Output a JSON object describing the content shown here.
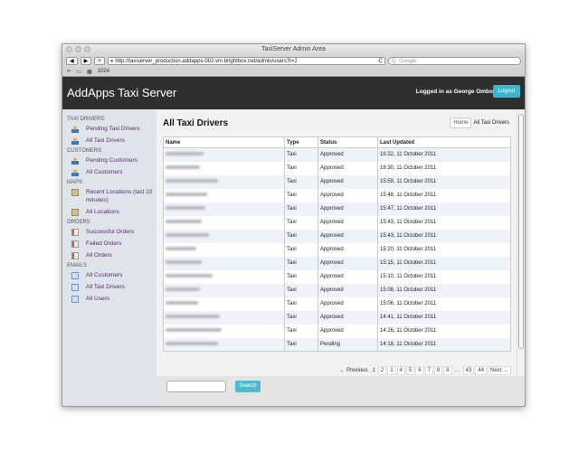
{
  "browser": {
    "title": "TaxiServer Admin Area",
    "url": "http://taxiserver_production.addapps-002.vm.brightbox.net/admin/users?t=2",
    "search_placeholder": "Google",
    "bookmark_label": "1024",
    "back": "◀",
    "forward": "▶",
    "add": "+",
    "reload": "C"
  },
  "header": {
    "brand": "AddApps Taxi Server",
    "logged_in": "Logged in as George Ombo",
    "logout": "Logout"
  },
  "sidebar": {
    "sections": [
      {
        "title": "TAXI DRIVERS",
        "items": [
          {
            "label": "Pending Taxi Drivers",
            "icon": "person-icon"
          },
          {
            "label": "All Taxi Drivers",
            "icon": "people-icon"
          }
        ]
      },
      {
        "title": "CUSTOMERS",
        "items": [
          {
            "label": "Pending Customers",
            "icon": "person-icon"
          },
          {
            "label": "All Customers",
            "icon": "people-icon"
          }
        ]
      },
      {
        "title": "MAPS",
        "items": [
          {
            "label": "Recent Locations (last 10 minutes)",
            "icon": "map-icon"
          },
          {
            "label": "All Locations",
            "icon": "map-icon"
          }
        ]
      },
      {
        "title": "ORDERS",
        "items": [
          {
            "label": "Successful Orders",
            "icon": "document-icon"
          },
          {
            "label": "Failed Orders",
            "icon": "document-icon"
          },
          {
            "label": "All Orders",
            "icon": "document-icon"
          }
        ]
      },
      {
        "title": "EMAILS",
        "items": [
          {
            "label": "All Customers",
            "icon": "mail-icon"
          },
          {
            "label": "All Taxi Drivers",
            "icon": "mail-icon"
          },
          {
            "label": "All Users",
            "icon": "mail-icon"
          }
        ]
      }
    ]
  },
  "main": {
    "title": "All Taxi Drivers",
    "breadcrumb": {
      "home": "Home",
      "current": "All Taxi Drivers"
    },
    "columns": [
      "Name",
      "Type",
      "Status",
      "Last Updated"
    ],
    "rows": [
      {
        "type": "Taxi",
        "status": "Approved",
        "updated": "16:32, 11 October 2011"
      },
      {
        "type": "Taxi",
        "status": "Approved",
        "updated": "16:30, 11 October 2011"
      },
      {
        "type": "Taxi",
        "status": "Approved",
        "updated": "15:59, 11 October 2011"
      },
      {
        "type": "Taxi",
        "status": "Approved",
        "updated": "15:48, 11 October 2011"
      },
      {
        "type": "Taxi",
        "status": "Approved",
        "updated": "15:47, 11 October 2011"
      },
      {
        "type": "Taxi",
        "status": "Approved",
        "updated": "15:43, 11 October 2011"
      },
      {
        "type": "Taxi",
        "status": "Approved",
        "updated": "15:43, 11 October 2011"
      },
      {
        "type": "Taxi",
        "status": "Approved",
        "updated": "15:20, 11 October 2011"
      },
      {
        "type": "Taxi",
        "status": "Approved",
        "updated": "15:15, 11 October 2011"
      },
      {
        "type": "Taxi",
        "status": "Approved",
        "updated": "15:10, 11 October 2011"
      },
      {
        "type": "Taxi",
        "status": "Approved",
        "updated": "15:08, 11 October 2011"
      },
      {
        "type": "Taxi",
        "status": "Approved",
        "updated": "15:06, 11 October 2011"
      },
      {
        "type": "Taxi",
        "status": "Approved",
        "updated": "14:41, 11 October 2011"
      },
      {
        "type": "Taxi",
        "status": "Approved",
        "updated": "14:26, 11 October 2011"
      },
      {
        "type": "Taxi",
        "status": "Pending",
        "updated": "14:18, 11 October 2011"
      }
    ],
    "pagination": {
      "previous": "← Previous",
      "current": "1",
      "pages": [
        "2",
        "3",
        "4",
        "5",
        "6",
        "7",
        "8",
        "9",
        "…",
        "43",
        "44"
      ],
      "next": "Next →"
    }
  },
  "search": {
    "value": "",
    "button": "Search"
  }
}
